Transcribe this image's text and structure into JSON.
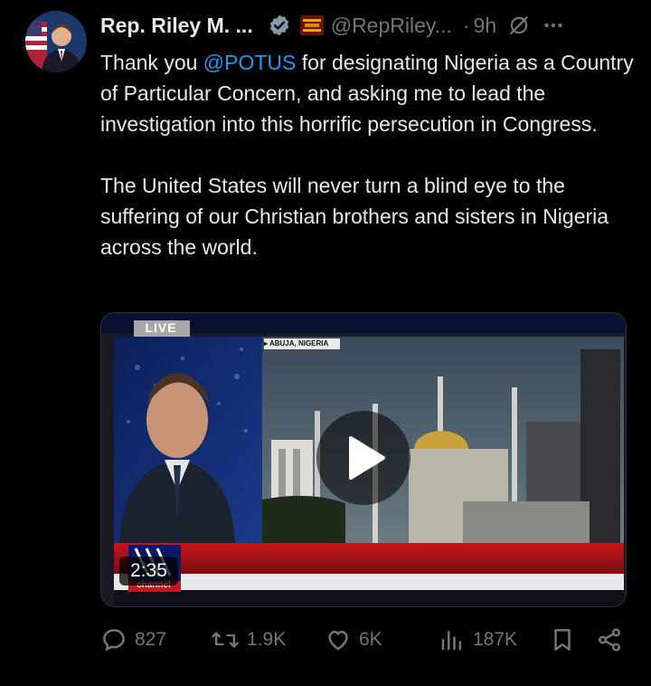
{
  "author": {
    "display_name": "Rep. Riley M. ...",
    "handle": "@RepRiley...",
    "separator": "·",
    "time": "9h"
  },
  "tweet": {
    "paragraph1_pre": "Thank you ",
    "mention": "@POTUS",
    "paragraph1_post": " for designating Nigeria as a Country of Particular Concern, and asking me to lead the investigation into this horrific persecution in Congress.",
    "paragraph2": "The United States will never turn a blind eye to the suffering of our Christian brothers and sisters in Nigeria across the world."
  },
  "media": {
    "live_label": "LIVE",
    "location": "▸ ABUJA, NIGERIA",
    "network_logo_text": "channel",
    "duration": "2:35"
  },
  "actions": {
    "replies": "827",
    "reposts": "1.9K",
    "likes": "6K",
    "views": "187K"
  },
  "colors": {
    "background": "#000000",
    "text": "#e7e9ea",
    "muted": "#71767b",
    "accent": "#1d9bf0"
  },
  "icons": [
    "verified-badge-icon",
    "affiliate-badge-icon",
    "grok-icon",
    "more-icon",
    "play-icon",
    "reply-icon",
    "repost-icon",
    "like-icon",
    "views-icon",
    "bookmark-icon",
    "share-icon"
  ]
}
